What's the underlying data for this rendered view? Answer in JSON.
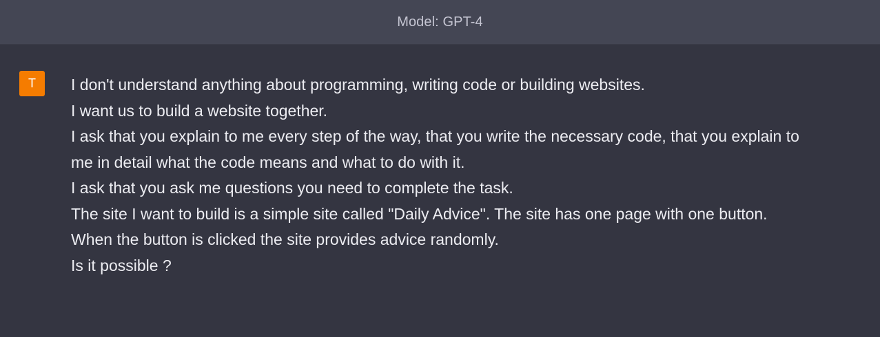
{
  "header": {
    "title": "Model: GPT-4"
  },
  "message": {
    "avatar_initial": "T",
    "avatar_color": "#f57c00",
    "lines": [
      "I don't understand anything about programming, writing code or building websites.",
      "I want us to build a website together.",
      "I ask that you explain to me every step of the way, that you write the necessary code, that you explain to me in detail what the code means and what to do with it.",
      "I ask that you ask me questions you need to complete the task.",
      "The site I want to build is a simple site called \"Daily Advice\". The site has one page with one button.",
      "When the button is clicked the site provides advice randomly.",
      "Is it possible ?"
    ]
  }
}
